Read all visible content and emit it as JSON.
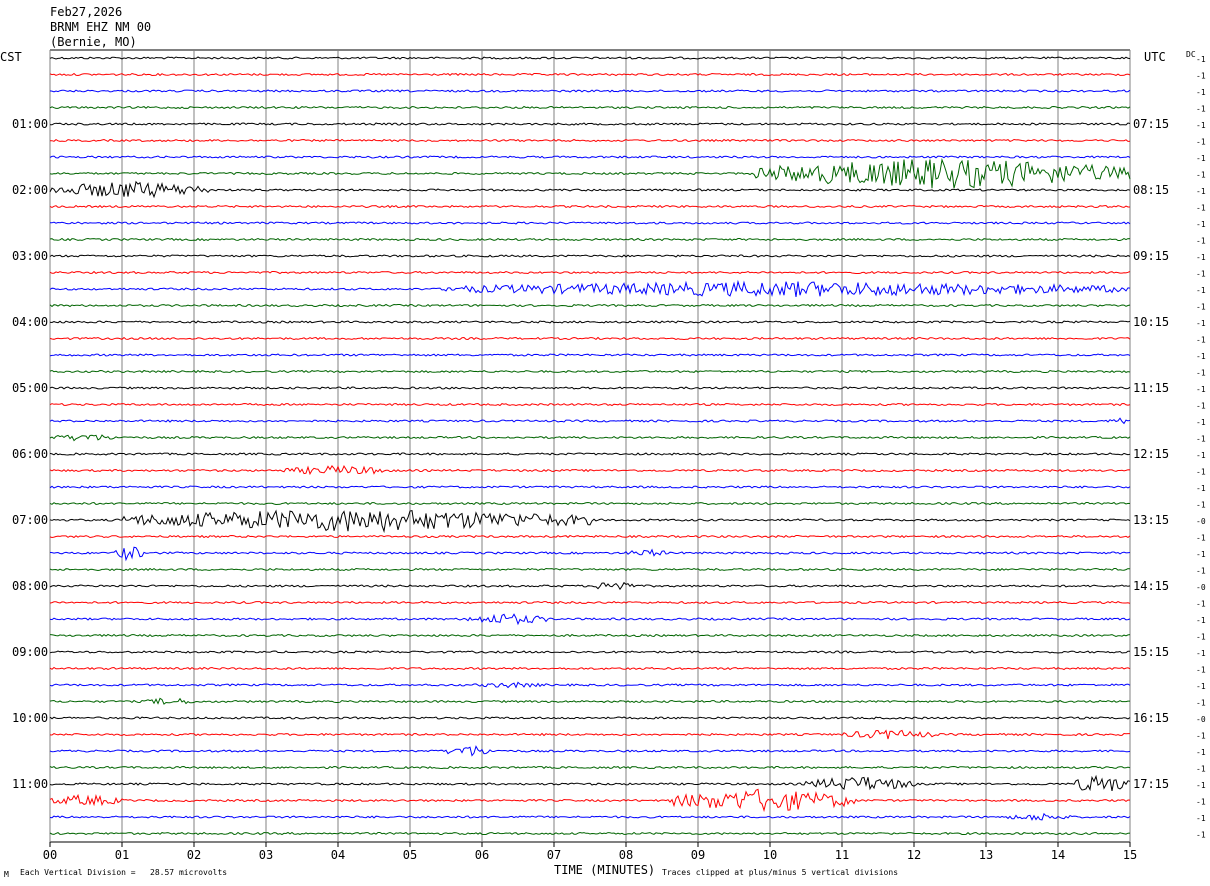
{
  "header": {
    "date": "Feb27,2026",
    "station": "BRNM EHZ NM 00",
    "location": "(Bernie, MO)"
  },
  "left_axis_title": "CST",
  "right_axis_title": "UTC",
  "dc_label": "DC",
  "footer": {
    "scale_note": "Each Vertical Division =   28.57 microvolts",
    "x_title": "TIME (MINUTES)",
    "clip_note": "Traces clipped at plus/minus 5 vertical divisions",
    "corner_mark": "M"
  },
  "colors": {
    "trace_cycle": [
      "#000000",
      "#ff0000",
      "#0000ff",
      "#006400"
    ],
    "grid": "#808080"
  },
  "chart_data": {
    "type": "line",
    "x_range": [
      0,
      15
    ],
    "x_ticks": [
      "00",
      "01",
      "02",
      "03",
      "04",
      "05",
      "06",
      "07",
      "08",
      "09",
      "10",
      "11",
      "12",
      "13",
      "14",
      "15"
    ],
    "trace_count": 48,
    "minutes_per_trace": 15,
    "left_time_labels": [
      {
        "trace": 4,
        "text": "01:00"
      },
      {
        "trace": 8,
        "text": "02:00"
      },
      {
        "trace": 12,
        "text": "03:00"
      },
      {
        "trace": 16,
        "text": "04:00"
      },
      {
        "trace": 20,
        "text": "05:00"
      },
      {
        "trace": 24,
        "text": "06:00"
      },
      {
        "trace": 28,
        "text": "07:00"
      },
      {
        "trace": 32,
        "text": "08:00"
      },
      {
        "trace": 36,
        "text": "09:00"
      },
      {
        "trace": 40,
        "text": "10:00"
      },
      {
        "trace": 44,
        "text": "11:00"
      }
    ],
    "right_time_labels": [
      {
        "trace": 4,
        "text": "07:15"
      },
      {
        "trace": 8,
        "text": "08:15"
      },
      {
        "trace": 12,
        "text": "09:15"
      },
      {
        "trace": 16,
        "text": "10:15"
      },
      {
        "trace": 20,
        "text": "11:15"
      },
      {
        "trace": 24,
        "text": "12:15"
      },
      {
        "trace": 28,
        "text": "13:15"
      },
      {
        "trace": 32,
        "text": "14:15"
      },
      {
        "trace": 36,
        "text": "15:15"
      },
      {
        "trace": 40,
        "text": "16:15"
      },
      {
        "trace": 44,
        "text": "17:15"
      }
    ],
    "dc_offsets": [
      "-1",
      "-1",
      "-1",
      "-1",
      "-1",
      "-1",
      "-1",
      "-1",
      "-1",
      "-1",
      "-1",
      "-1",
      "-1",
      "-1",
      "-1",
      "-1",
      "-1",
      "-1",
      "-1",
      "-1",
      "-1",
      "-1",
      "-1",
      "-1",
      "-1",
      "-1",
      "-1",
      "-1",
      "-0",
      "-1",
      "-1",
      "-1",
      "-0",
      "-1",
      "-1",
      "-1",
      "-1",
      "-1",
      "-1",
      "-1",
      "-0",
      "-1",
      "-1",
      "-1",
      "-1",
      "-1",
      "-1",
      "-1"
    ],
    "events": [
      {
        "trace": 7,
        "start_min": 9.8,
        "end_min": 15.0,
        "amplitude": 16
      },
      {
        "trace": 8,
        "start_min": 0.0,
        "end_min": 2.2,
        "amplitude": 9
      },
      {
        "trace": 14,
        "start_min": 5.5,
        "end_min": 15.0,
        "amplitude": 8
      },
      {
        "trace": 23,
        "start_min": 0.0,
        "end_min": 1.0,
        "amplitude": 4
      },
      {
        "trace": 22,
        "start_min": 14.7,
        "end_min": 15.0,
        "amplitude": 4
      },
      {
        "trace": 25,
        "start_min": 3.2,
        "end_min": 4.8,
        "amplitude": 5
      },
      {
        "trace": 28,
        "start_min": 1.0,
        "end_min": 7.5,
        "amplitude": 12
      },
      {
        "trace": 30,
        "start_min": 0.9,
        "end_min": 1.3,
        "amplitude": 8
      },
      {
        "trace": 30,
        "start_min": 8.0,
        "end_min": 8.6,
        "amplitude": 4
      },
      {
        "trace": 32,
        "start_min": 7.6,
        "end_min": 8.1,
        "amplitude": 7
      },
      {
        "trace": 34,
        "start_min": 5.8,
        "end_min": 6.9,
        "amplitude": 6
      },
      {
        "trace": 38,
        "start_min": 5.9,
        "end_min": 6.9,
        "amplitude": 3
      },
      {
        "trace": 39,
        "start_min": 1.3,
        "end_min": 2.0,
        "amplitude": 4
      },
      {
        "trace": 41,
        "start_min": 11.0,
        "end_min": 12.3,
        "amplitude": 5
      },
      {
        "trace": 42,
        "start_min": 5.5,
        "end_min": 6.2,
        "amplitude": 6
      },
      {
        "trace": 44,
        "start_min": 10.5,
        "end_min": 12.0,
        "amplitude": 8
      },
      {
        "trace": 44,
        "start_min": 14.2,
        "end_min": 15.0,
        "amplitude": 10
      },
      {
        "trace": 45,
        "start_min": 0.0,
        "end_min": 1.0,
        "amplitude": 6
      },
      {
        "trace": 45,
        "start_min": 8.6,
        "end_min": 11.2,
        "amplitude": 12
      },
      {
        "trace": 46,
        "start_min": 13.3,
        "end_min": 14.2,
        "amplitude": 4
      }
    ]
  }
}
